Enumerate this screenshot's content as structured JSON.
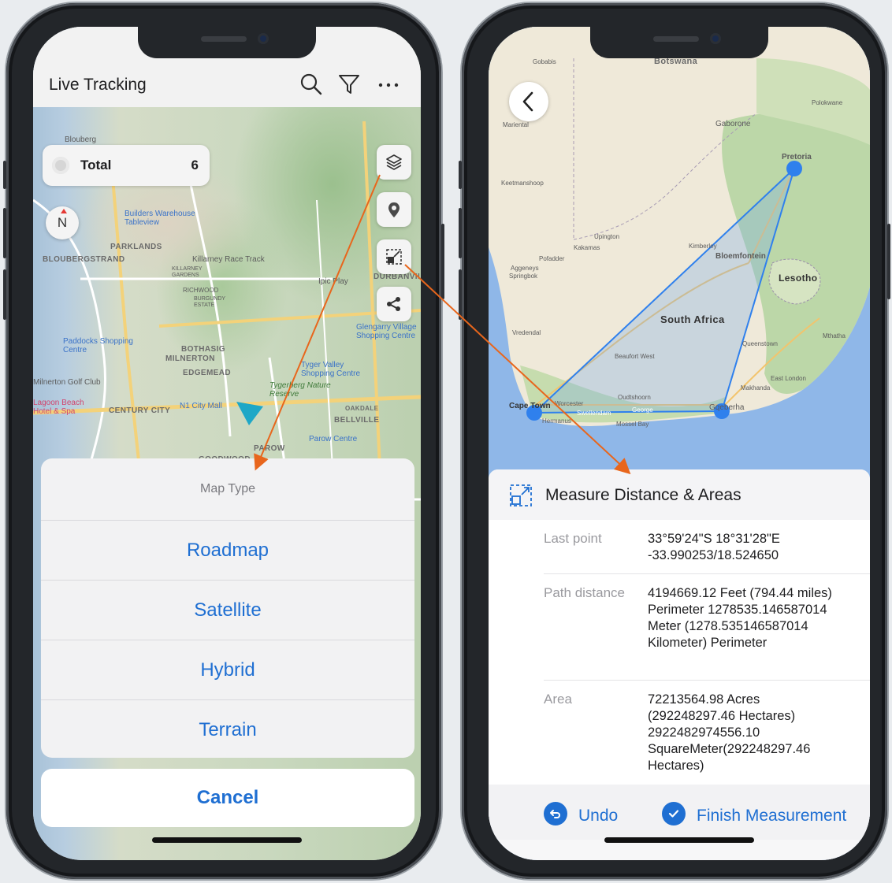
{
  "left_phone": {
    "header": {
      "title": "Live Tracking",
      "icons": [
        "search-icon",
        "filter-icon",
        "more-icon"
      ]
    },
    "total_card": {
      "label": "Total",
      "count": "6"
    },
    "compass_label": "N",
    "map_controls": [
      "layers-icon",
      "location-pin-icon",
      "measure-icon",
      "share-icon"
    ],
    "map_labels": [
      "Blouberg",
      "Builders Warehouse Tableview",
      "PARKLANDS",
      "BLOUBERGSTRAND",
      "Killarney Race Track",
      "KILLARNEY GARDENS",
      "RICHWOOD",
      "BURGUNDY ESTATE",
      "Ipic Play",
      "DURBANVILLE",
      "Glengarry Village Shopping Centre",
      "Paddocks Shopping Centre",
      "BOTHASIG",
      "MILNERTON",
      "EDGEMEAD",
      "Tyger Valley Shopping Centre",
      "Tygerberg Nature Reserve",
      "Milnerton Golf Club",
      "Lagoon Beach Hotel & Spa",
      "CENTURY CITY",
      "N1 City Mall",
      "OAKDALE",
      "BELLVILLE",
      "Parow Centre",
      "PAROW",
      "GOODWOOD"
    ],
    "action_sheet": {
      "title": "Map Type",
      "options": [
        "Roadmap",
        "Satellite",
        "Hybrid",
        "Terrain"
      ],
      "cancel": "Cancel"
    }
  },
  "right_phone": {
    "map_labels": {
      "countries": [
        "Botswana",
        "South Africa",
        "Lesotho"
      ],
      "cities": [
        "Gaborone",
        "Pretoria",
        "Bloemfontein",
        "Cape Town",
        "Gqeberha",
        "Upington",
        "Kimberley",
        "East London",
        "Queenstown",
        "Mthatha",
        "Makhanda",
        "George",
        "Oudtshoorn",
        "Beaufort West",
        "Mossel Bay",
        "Hermanus",
        "Worcester",
        "Vredendal",
        "Keetmanshoop",
        "Mariental",
        "Kakamas",
        "Pofadder",
        "Aggeneys",
        "Springbok",
        "Polokwane",
        "Gobabis",
        "Swellendam"
      ]
    },
    "measure_panel": {
      "title": "Measure Distance & Areas",
      "rows": [
        {
          "key": "Last point",
          "value": "33°59'24\"S 18°31'28\"E\n-33.990253/18.524650"
        },
        {
          "key": "Path distance",
          "value": "4194669.12 Feet (794.44 miles) Perimeter 1278535.146587014 Meter (1278.535146587014 Kilometer) Perimeter"
        },
        {
          "key": "Area",
          "value": "72213564.98 Acres (292248297.46 Hectares) 2922482974556.10 SquareMeter(292248297.46 Hectares)"
        }
      ],
      "undo_label": "Undo",
      "finish_label": "Finish Measurement"
    }
  },
  "colors": {
    "accent_blue": "#1f6fd2",
    "annotation_arrow": "#e8661c",
    "polygon_stroke": "#2f80ed",
    "phone_frame": "#23262a"
  }
}
